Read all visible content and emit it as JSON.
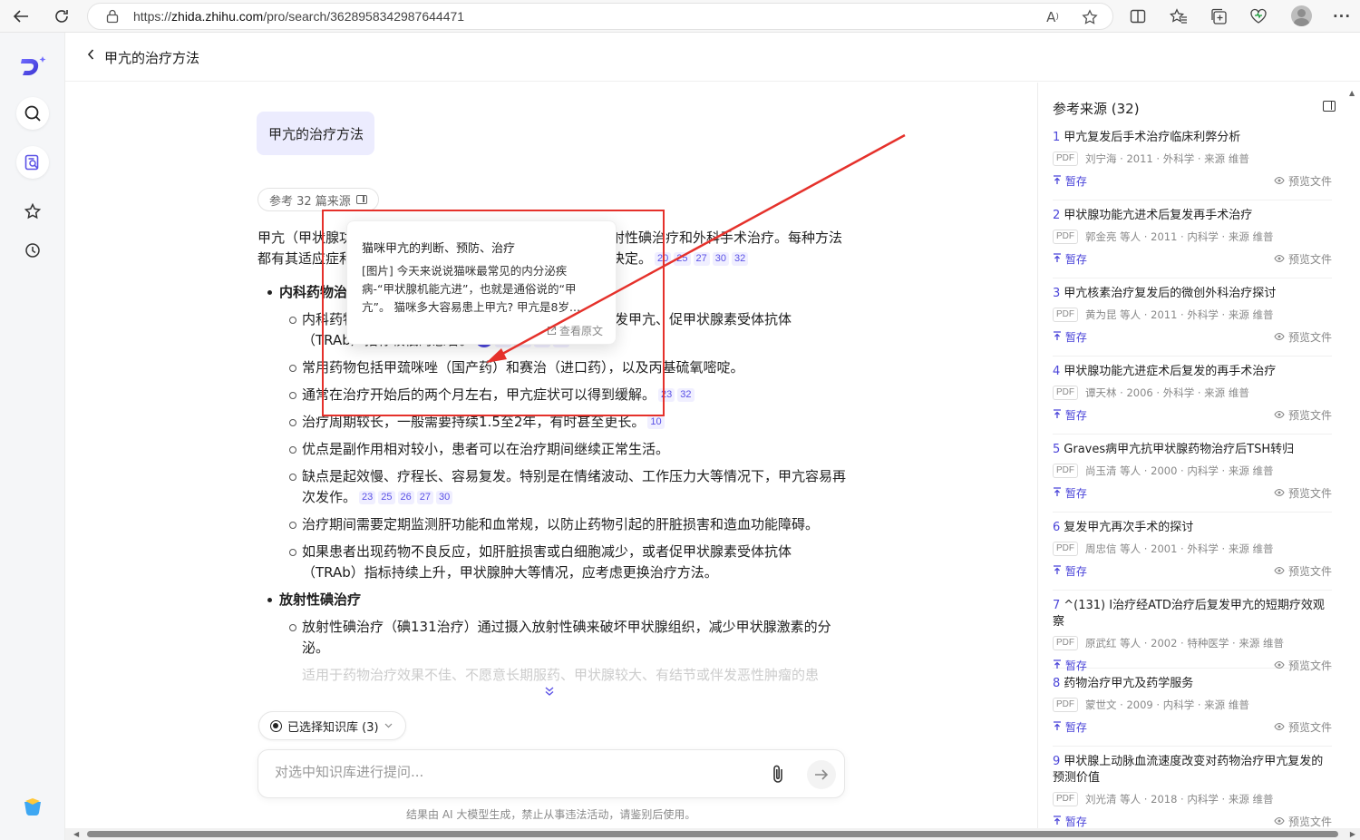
{
  "browser": {
    "url_prefix": "https://",
    "url_host": "zhida.zhihu.com",
    "url_path": "/pro/search/3628958342987644471"
  },
  "header": {
    "title": "甲亢的治疗方法"
  },
  "question": "甲亢的治疗方法",
  "ref_pill": "参考 32 篇来源",
  "answer": {
    "intro_a": "甲亢（甲状腺功",
    "intro_b": "亢进症）的治疗方法主要包括药物治疗、放射性碘治疗和外科手术治疗。每种方法都有其适应症和优缺点，具体选择需根据患者的具体情况来决定。",
    "intro_cites": [
      "20",
      "25",
      "27",
      "30",
      "32"
    ],
    "section1": "内科药物治疗",
    "s1_items": [
      {
        "text": "内科药物治疗适用于病情较轻、甲状腺肿大较小、初发甲亢、促甲状腺素受体抗体（TRAb）指标较低的患者。",
        "cites": [
          "25",
          "27",
          "30",
          "32"
        ],
        "hl": "18"
      },
      {
        "text": "常用药物包括甲巯咪唑（国产药）和赛治（进口药），以及丙基硫氧嘧啶。",
        "cites": []
      },
      {
        "text": "通常在治疗开始后的两个月左右，甲亢症状可以得到缓解。",
        "cites": [
          "23",
          "32"
        ]
      },
      {
        "text": "治疗周期较长，一般需要持续1.5至2年，有时甚至更长。",
        "cites": [
          "10"
        ]
      },
      {
        "text": "优点是副作用相对较小，患者可以在治疗期间继续正常生活。",
        "cites": []
      },
      {
        "text": "缺点是起效慢、疗程长、容易复发。特别是在情绪波动、工作压力大等情况下，甲亢容易再次发作。",
        "cites": [
          "23",
          "25",
          "26",
          "27",
          "30"
        ]
      },
      {
        "text": "治疗期间需要定期监测肝功能和血常规，以防止药物引起的肝脏损害和造血功能障碍。",
        "cites": []
      },
      {
        "text": "如果患者出现药物不良反应，如肝脏损害或白细胞减少，或者促甲状腺素受体抗体（TRAb）指标持续上升，甲状腺肿大等情况，应考虑更换治疗方法。",
        "cites": []
      }
    ],
    "section2": "放射性碘治疗",
    "s2_items": [
      {
        "text": "放射性碘治疗（碘131治疗）通过摄入放射性碘来破坏甲状腺组织，减少甲状腺激素的分泌。",
        "cites": []
      }
    ],
    "fade_text": "适用于药物治疗效果不佳、不愿意长期服药、甲状腺较大、有结节或伴发恶性肿瘤的患"
  },
  "popover": {
    "title": "猫咪甲亢的判断、预防、治疗",
    "body": "[图片] 今天来说说猫咪最常见的内分泌疾病-“甲状腺机能亢进”，也就是通俗说的“甲亢”。 猫咪多大容易患上甲亢? 甲亢是8岁...",
    "link": "查看原文"
  },
  "kb_chip": "已选择知识库 (3)",
  "input": {
    "placeholder": "对选中知识库进行提问..."
  },
  "disclaimer": "结果由 AI 大模型生成，禁止从事违法活动，请鉴别后使用。",
  "sources": {
    "title": "参考来源 (32)",
    "save_label": "暂存",
    "preview_label": "预览文件",
    "items": [
      {
        "num": "1",
        "title": "甲亢复发后手术治疗临床利弊分析",
        "meta": "刘宁海 · 2011 · 外科学 · 来源 维普"
      },
      {
        "num": "2",
        "title": "甲状腺功能亢进术后复发再手术治疗",
        "meta": "郭金亮 等人 · 2011 · 内科学 · 来源 维普"
      },
      {
        "num": "3",
        "title": "甲亢核素治疗复发后的微创外科治疗探讨",
        "meta": "黄为昆 等人 · 2011 · 外科学 · 来源 维普"
      },
      {
        "num": "4",
        "title": "甲状腺功能亢进症术后复发的再手术治疗",
        "meta": "谭天林 · 2006 · 外科学 · 来源 维普"
      },
      {
        "num": "5",
        "title": "Graves病甲亢抗甲状腺药物治疗后TSH转归",
        "meta": "尚玉清 等人 · 2000 · 内科学 · 来源 维普"
      },
      {
        "num": "6",
        "title": "复发甲亢再次手术的探讨",
        "meta": "周忠信 等人 · 2001 · 外科学 · 来源 维普"
      },
      {
        "num": "7",
        "title": "^(131) Ⅰ治疗经ATD治疗后复发甲亢的短期疗效观察",
        "meta": "原武红 等人 · 2002 · 特种医学 · 来源 维普"
      },
      {
        "num": "8",
        "title": "药物治疗甲亢及药学服务",
        "meta": "蒙世文 · 2009 · 内科学 · 来源 维普"
      },
      {
        "num": "9",
        "title": "甲状腺上动脉血流速度改变对药物治疗甲亢复发的预测价值",
        "meta": "刘光清 等人 · 2018 · 内科学 · 来源 维普"
      }
    ]
  },
  "colors": {
    "accent": "#4b45d9",
    "annotation": "#e5312b",
    "bubble": "#ececfe"
  }
}
